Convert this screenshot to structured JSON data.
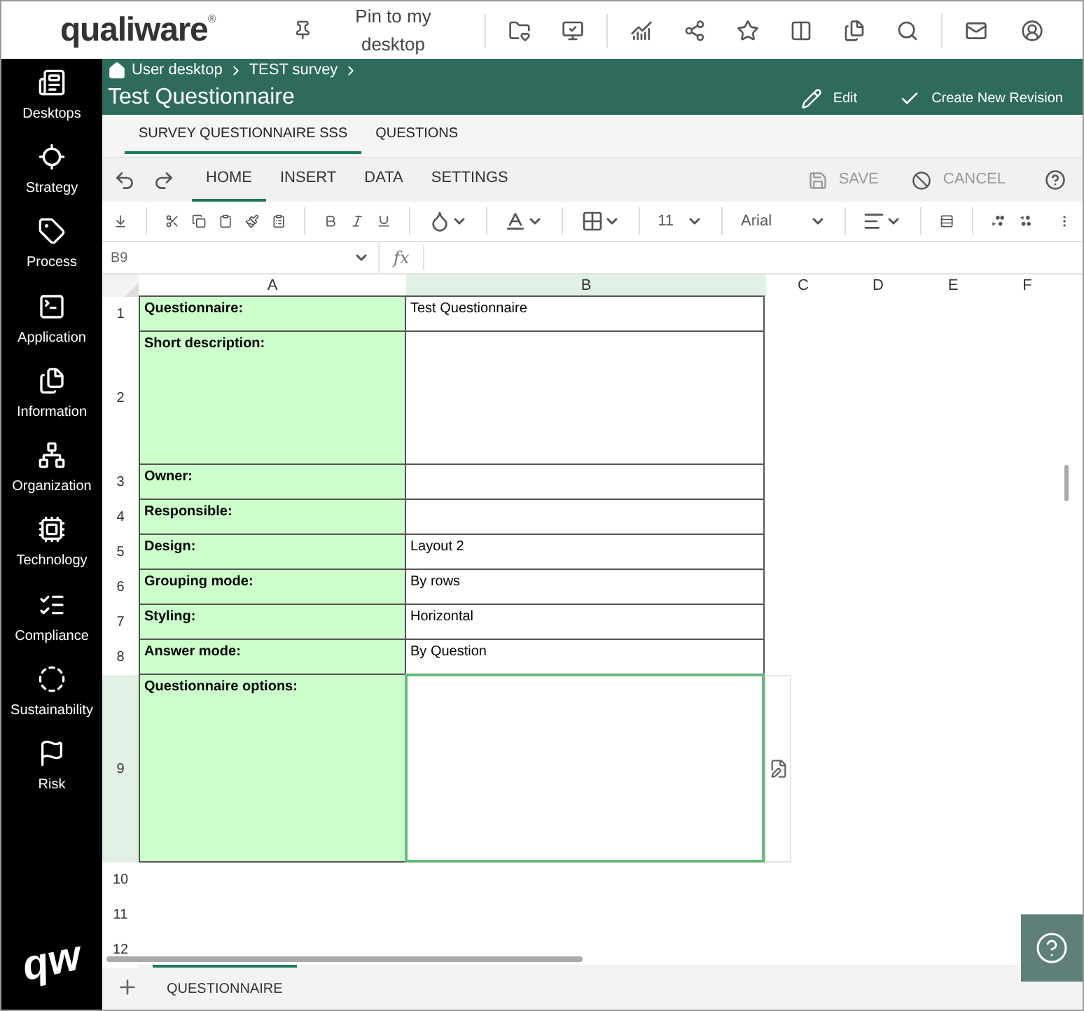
{
  "header": {
    "logo": "qualiware",
    "logo_mark": "®",
    "pin_label": "Pin to my desktop"
  },
  "sidebar": {
    "items": [
      {
        "label": "Desktops"
      },
      {
        "label": "Strategy"
      },
      {
        "label": "Process"
      },
      {
        "label": "Application"
      },
      {
        "label": "Information"
      },
      {
        "label": "Organization"
      },
      {
        "label": "Technology"
      },
      {
        "label": "Compliance"
      },
      {
        "label": "Sustainability"
      },
      {
        "label": "Risk"
      }
    ],
    "logo": "qw"
  },
  "breadcrumbs": [
    "User desktop",
    "TEST survey"
  ],
  "title": "Test Questionnaire",
  "actions": [
    "Edit",
    "Create New Revision"
  ],
  "doc_tabs": [
    {
      "label": "SURVEY QUESTIONNAIRE SSS",
      "selected": true
    },
    {
      "label": "QUESTIONS",
      "selected": false
    }
  ],
  "ribbon_tabs": [
    {
      "label": "HOME",
      "selected": true
    },
    {
      "label": "INSERT",
      "selected": false
    },
    {
      "label": "DATA",
      "selected": false
    },
    {
      "label": "SETTINGS",
      "selected": false
    }
  ],
  "ribbon_actions": {
    "save": "SAVE",
    "cancel": "CANCEL"
  },
  "toolbar": {
    "font_size": "11",
    "font": "Arial"
  },
  "formula_bar": {
    "name_box": "B9",
    "fx": "fx"
  },
  "columns": [
    {
      "label": "A",
      "selected": false
    },
    {
      "label": "B",
      "selected": true
    },
    {
      "label": "C",
      "selected": false
    },
    {
      "label": "D",
      "selected": false
    },
    {
      "label": "E",
      "selected": false
    },
    {
      "label": "F",
      "selected": false
    }
  ],
  "rows": [
    {
      "number": "1",
      "selected": false,
      "label": "Questionnaire:",
      "value": "Test Questionnaire"
    },
    {
      "number": "2",
      "selected": false,
      "label": "Short description:"
    },
    {
      "number": "3",
      "selected": false,
      "label": "Owner:"
    },
    {
      "number": "4",
      "selected": false,
      "label": "Responsible:"
    },
    {
      "number": "5",
      "selected": false,
      "label": "Design:",
      "value": "Layout 2"
    },
    {
      "number": "6",
      "selected": false,
      "label": "Grouping mode:",
      "value": "By rows"
    },
    {
      "number": "7",
      "selected": false,
      "label": "Styling:",
      "value": "Horizontal"
    },
    {
      "number": "8",
      "selected": false,
      "label": "Answer mode:",
      "value": "By Question"
    },
    {
      "number": "9",
      "selected": true,
      "label": "Questionnaire options:"
    },
    {
      "number": "10",
      "selected": false
    },
    {
      "number": "11",
      "selected": false
    },
    {
      "number": "12",
      "selected": false
    }
  ],
  "sheet_tabs": [
    {
      "label": "QUESTIONNAIRE",
      "selected": true
    }
  ]
}
